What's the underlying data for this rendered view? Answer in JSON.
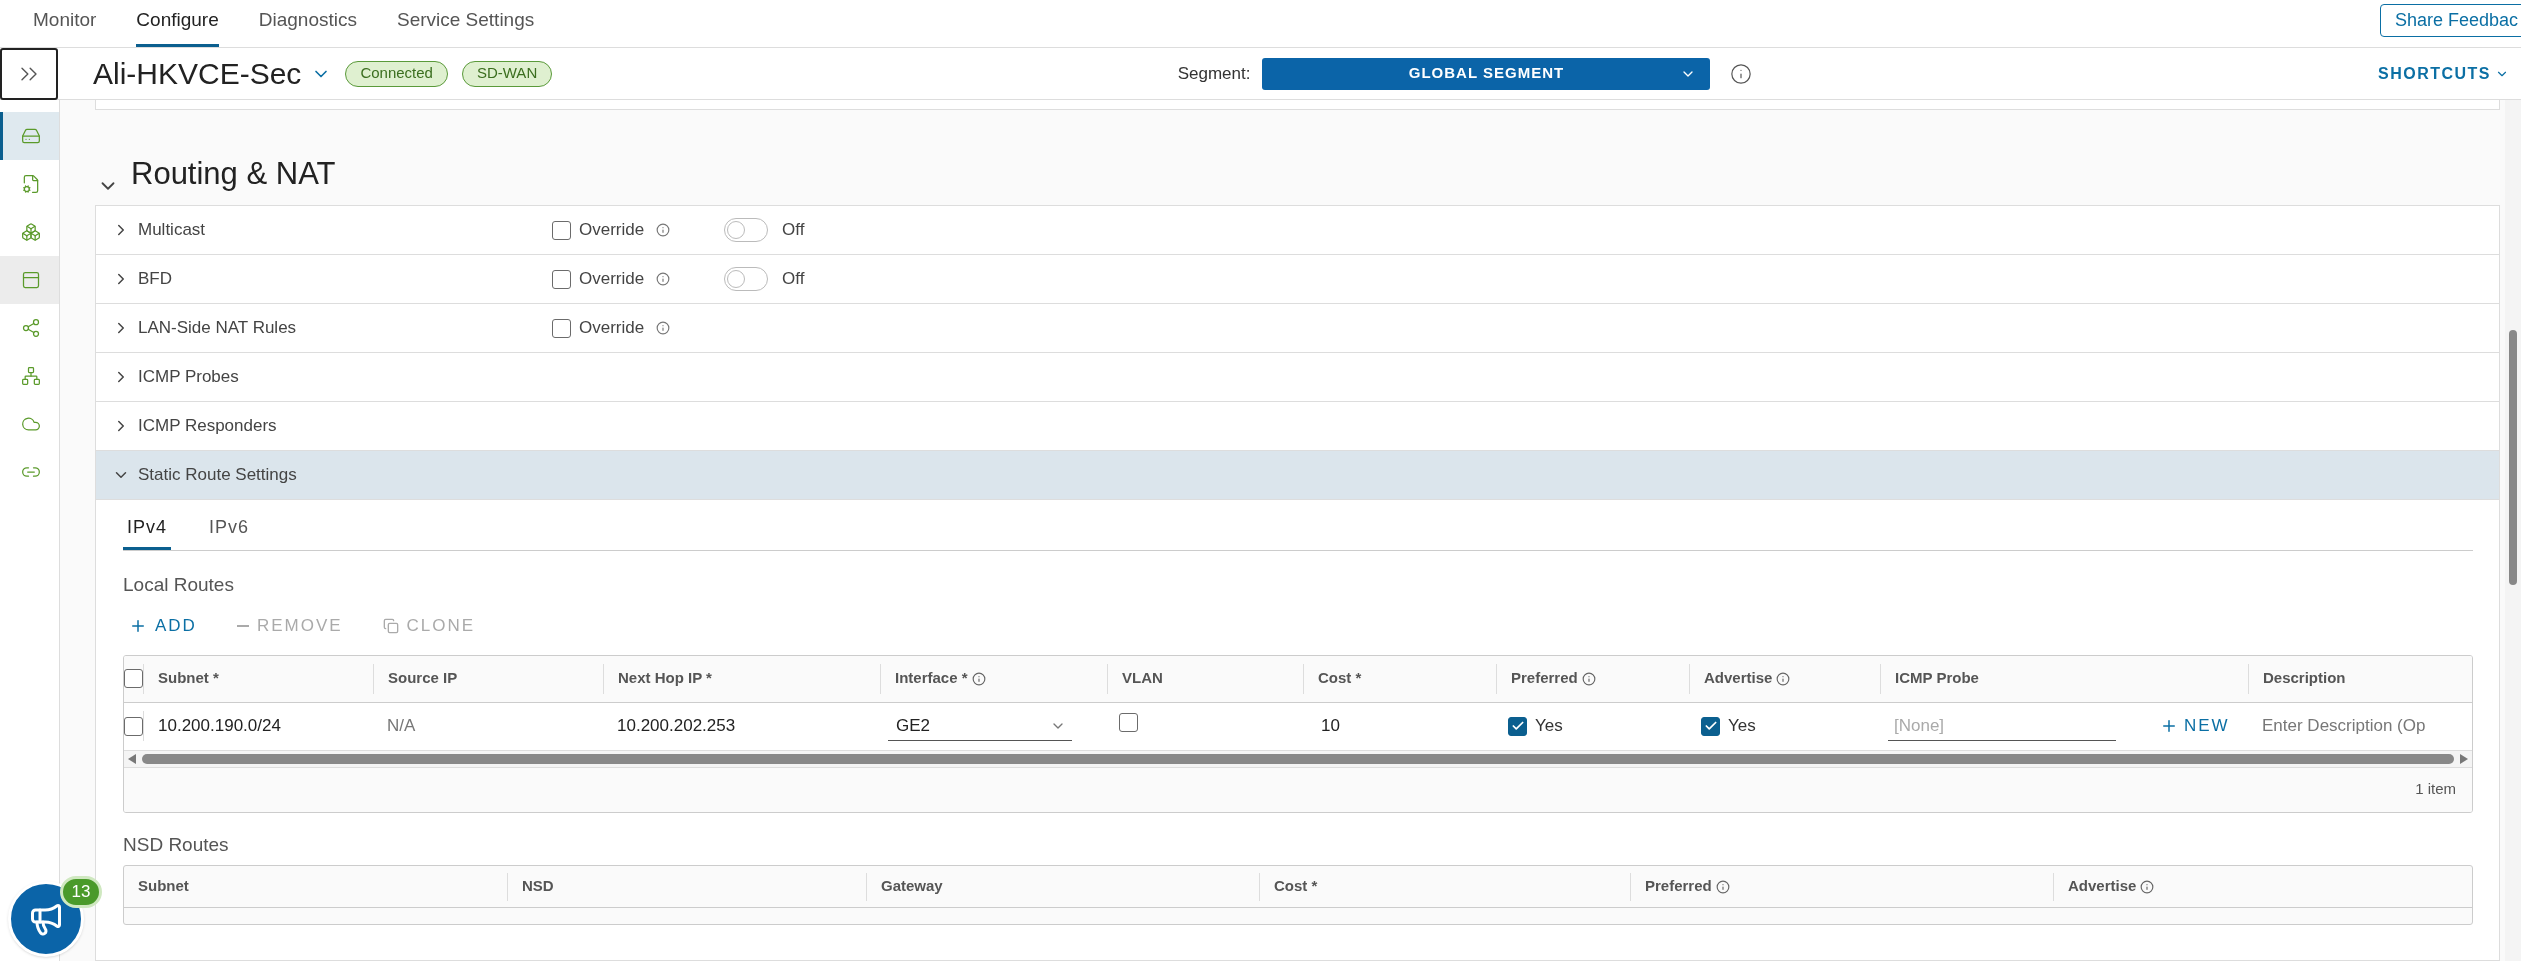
{
  "top_tabs": [
    {
      "label": "Monitor",
      "selected": false
    },
    {
      "label": "Configure",
      "selected": true
    },
    {
      "label": "Diagnostics",
      "selected": false
    },
    {
      "label": "Service Settings",
      "selected": false
    }
  ],
  "share_feedback": "Share Feedbac",
  "edge": {
    "name": "Ali-HKVCE-Sec",
    "badges": [
      "Connected",
      "SD-WAN"
    ]
  },
  "segment": {
    "label": "Segment:",
    "value": "GLOBAL SEGMENT"
  },
  "shortcuts": "SHORTCUTS",
  "sidebar": [
    {
      "kind": "drive",
      "selected": true,
      "highlighted": false
    },
    {
      "kind": "doc-gear",
      "selected": false,
      "highlighted": false
    },
    {
      "kind": "boxes",
      "selected": false,
      "highlighted": false
    },
    {
      "kind": "panel",
      "selected": false,
      "highlighted": true
    },
    {
      "kind": "share",
      "selected": false,
      "highlighted": false
    },
    {
      "kind": "network",
      "selected": false,
      "highlighted": false
    },
    {
      "kind": "clouds",
      "selected": false,
      "highlighted": false
    },
    {
      "kind": "link",
      "selected": false,
      "highlighted": false
    }
  ],
  "section": {
    "title": "Routing & NAT",
    "expanded": true
  },
  "settings_rows": [
    {
      "label": "Multicast",
      "expanded": false,
      "override": {
        "label": "Override",
        "checked": false
      },
      "toggle": {
        "on": false,
        "label": "Off"
      }
    },
    {
      "label": "BFD",
      "expanded": false,
      "override": {
        "label": "Override",
        "checked": false
      },
      "toggle": {
        "on": false,
        "label": "Off"
      }
    },
    {
      "label": "LAN-Side NAT Rules",
      "expanded": false,
      "override": {
        "label": "Override",
        "checked": false
      }
    },
    {
      "label": "ICMP Probes",
      "expanded": false
    },
    {
      "label": "ICMP Responders",
      "expanded": false
    },
    {
      "label": "Static Route Settings",
      "expanded": true
    }
  ],
  "static_routes": {
    "tabs": [
      {
        "label": "IPv4",
        "selected": true
      },
      {
        "label": "IPv6",
        "selected": false
      }
    ],
    "local_routes": {
      "title": "Local Routes",
      "actions": [
        {
          "kind": "add",
          "label": "ADD",
          "disabled": false
        },
        {
          "kind": "remove",
          "label": "REMOVE",
          "disabled": true
        },
        {
          "kind": "clone",
          "label": "CLONE",
          "disabled": true
        }
      ],
      "select_all_checked": false,
      "columns": [
        {
          "label": "Subnet *",
          "info": false
        },
        {
          "label": "Source IP",
          "info": false
        },
        {
          "label": "Next Hop IP *",
          "info": false
        },
        {
          "label": "Interface *",
          "info": true
        },
        {
          "label": "VLAN",
          "info": false
        },
        {
          "label": "Cost *",
          "info": false
        },
        {
          "label": "Preferred",
          "info": true
        },
        {
          "label": "Advertise",
          "info": true
        },
        {
          "label": "ICMP Probe",
          "info": false
        },
        {
          "label": "Description",
          "info": false
        }
      ],
      "rows": [
        {
          "selected": false,
          "subnet": "10.200.190.0/24",
          "source_ip": "N/A",
          "next_hop": "10.200.202.253",
          "interface": "GE2",
          "vlan_checked": false,
          "cost": "10",
          "preferred": {
            "checked": true,
            "label": "Yes"
          },
          "advertise": {
            "checked": true,
            "label": "Yes"
          },
          "icmp_probe": {
            "placeholder": "[None]",
            "new_label": "NEW"
          },
          "description": {
            "placeholder": "Enter Description (Op"
          }
        }
      ],
      "footer": "1 item"
    },
    "nsd_routes": {
      "title": "NSD Routes",
      "columns": [
        {
          "label": "Subnet",
          "info": false
        },
        {
          "label": "NSD",
          "info": false
        },
        {
          "label": "Gateway",
          "info": false
        },
        {
          "label": "Cost *",
          "info": false
        },
        {
          "label": "Preferred",
          "info": true
        },
        {
          "label": "Advertise",
          "info": true
        }
      ]
    }
  },
  "feedback_badge": "13"
}
